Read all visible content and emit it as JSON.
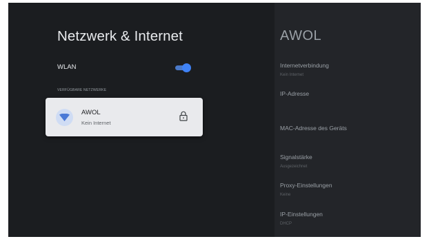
{
  "left": {
    "title": "Netzwerk & Internet",
    "wlan": {
      "label": "WLAN",
      "enabled": true
    },
    "available_networks_label": "VERFÜGBARE NETZWERKE",
    "networks": [
      {
        "name": "AWOL",
        "status": "Kein Internet",
        "secured": true,
        "icon": "wifi-icon"
      }
    ]
  },
  "detail": {
    "title": "AWOL",
    "items": [
      {
        "label": "Internetverbindung",
        "value": "Kein Internet"
      },
      {
        "label": "IP-Adresse",
        "value": ""
      },
      {
        "label": "MAC-Adresse des Geräts",
        "value": ""
      },
      {
        "label": "Signalstärke",
        "value": "Ausgezeichnet"
      },
      {
        "label": "Proxy-Einstellungen",
        "value": "Keine"
      },
      {
        "label": "IP-Einstellungen",
        "value": "DHCP"
      }
    ]
  },
  "colors": {
    "background": "#1b1d20",
    "panel": "#232529",
    "accent": "#3f82f6",
    "card": "#e9eaed"
  }
}
